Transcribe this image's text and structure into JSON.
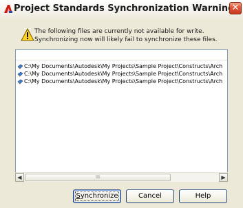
{
  "window": {
    "title": "Project Standards Synchronization Warning",
    "close_glyph": "✕",
    "app_icon": "autocad-a-icon"
  },
  "message": {
    "icon": "warning-icon",
    "text": "The following files are currently not available for write. Synchronizing now will likely fail to synchronize these files."
  },
  "file_list": {
    "rows": [
      {
        "path": "C:\\My Documents\\Autodesk\\My Projects\\Sample Project\\Constructs\\Arch"
      },
      {
        "path": "C:\\My Documents\\Autodesk\\My Projects\\Sample Project\\Constructs\\Arch"
      },
      {
        "path": "C:\\My Documents\\Autodesk\\My Projects\\Sample Project\\Constructs\\Arch"
      }
    ],
    "row_icon": "drawing-file-icon"
  },
  "scrollbar": {
    "left_arrow": "◀",
    "right_arrow": "▶",
    "thumb_grip": "III"
  },
  "buttons": {
    "synchronize_mnemonic": "S",
    "synchronize_rest": "ynchronize",
    "cancel": "Cancel",
    "help": "Help"
  }
}
